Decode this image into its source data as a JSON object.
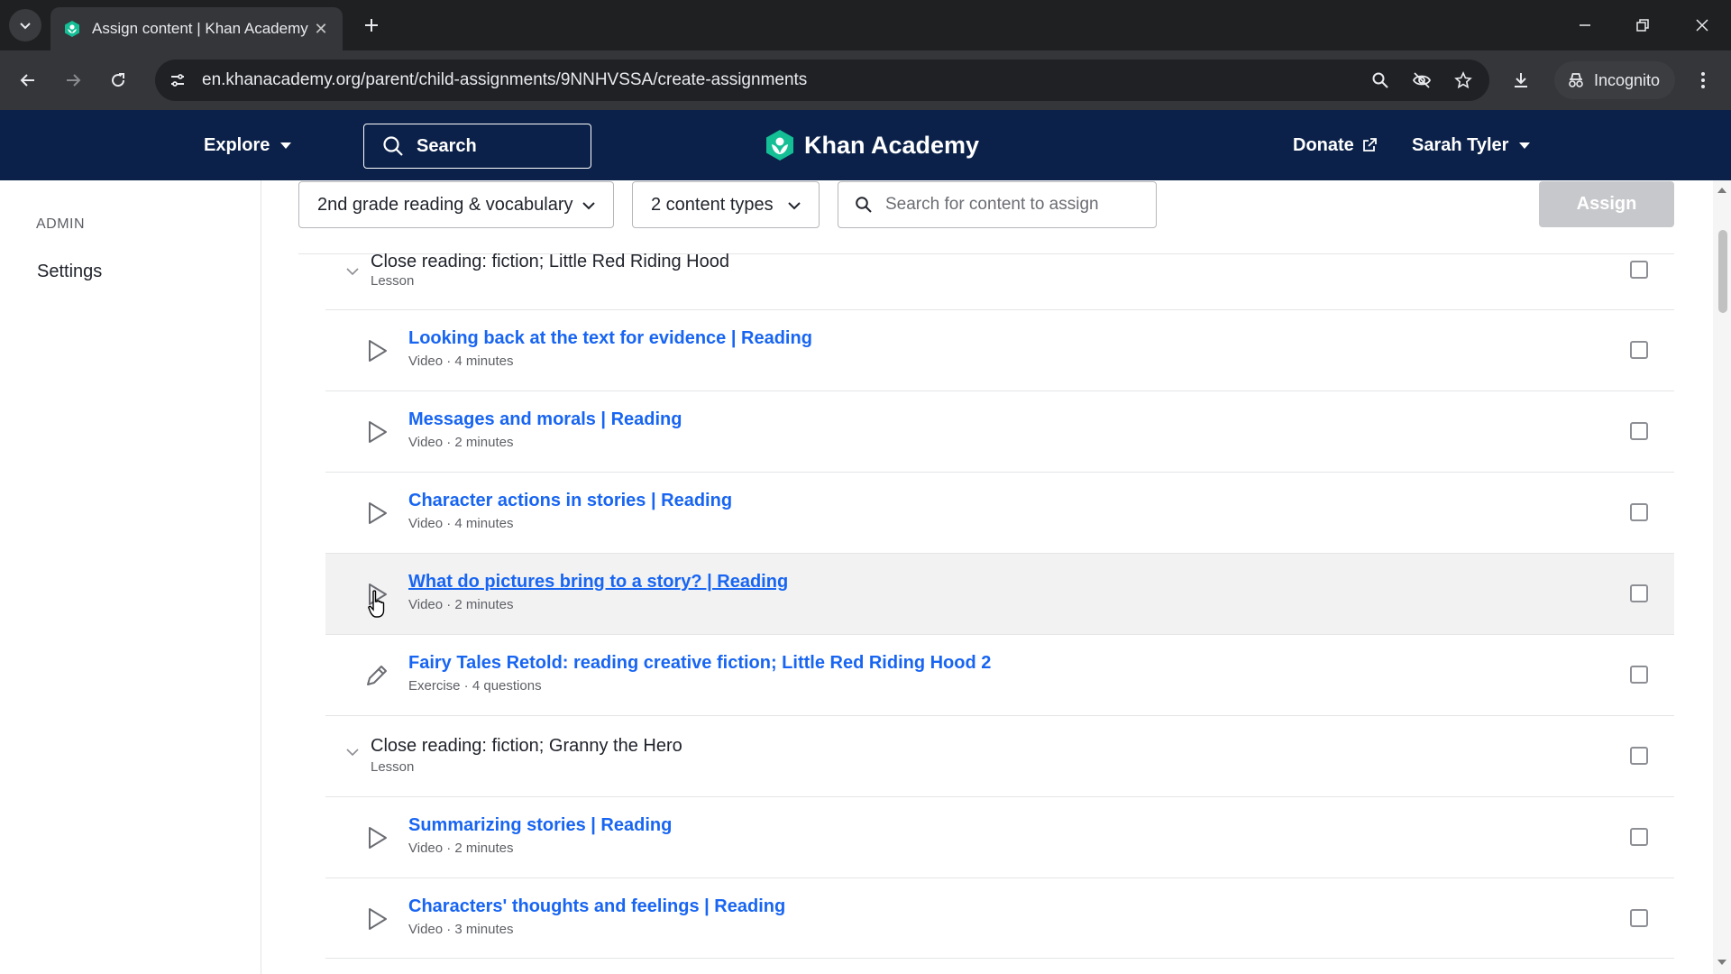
{
  "browser": {
    "tab_title": "Assign content | Khan Academy",
    "url": "en.khanacademy.org/parent/child-assignments/9NNHVSSA/create-assignments",
    "incognito_label": "Incognito"
  },
  "header": {
    "explore_label": "Explore",
    "search_label": "Search",
    "brand": "Khan Academy",
    "donate_label": "Donate",
    "user_name": "Sarah Tyler"
  },
  "sidebar": {
    "section_label": "ADMIN",
    "settings_label": "Settings"
  },
  "filters": {
    "course": "2nd grade reading & vocabulary",
    "content_types": "2 content types",
    "search_placeholder": "Search for content to assign",
    "assign_label": "Assign"
  },
  "content": {
    "lesson1": {
      "title": "Close reading: fiction; Little Red Riding Hood",
      "type": "Lesson"
    },
    "lesson2": {
      "title": "Close reading: fiction; Granny the Hero",
      "type": "Lesson"
    },
    "items": [
      {
        "title": "Looking back at the text for evidence | Reading",
        "meta": "Video · 4 minutes",
        "icon": "play-icon"
      },
      {
        "title": "Messages and morals | Reading",
        "meta": "Video · 2 minutes",
        "icon": "play-icon"
      },
      {
        "title": "Character actions in stories | Reading",
        "meta": "Video · 4 minutes",
        "icon": "play-icon"
      },
      {
        "title": "What do pictures bring to a story? | Reading",
        "meta": "Video · 2 minutes",
        "icon": "play-icon"
      },
      {
        "title": "Fairy Tales Retold: reading creative fiction; Little Red Riding Hood 2",
        "meta": "Exercise · 4 questions",
        "icon": "pencil-icon"
      },
      {
        "title": "Summarizing stories | Reading",
        "meta": "Video · 2 minutes",
        "icon": "play-icon"
      },
      {
        "title": "Characters' thoughts and feelings | Reading",
        "meta": "Video · 3 minutes",
        "icon": "play-icon"
      }
    ]
  },
  "colors": {
    "header_bg": "#0b2149",
    "link_blue": "#1865f2",
    "brand_green": "#14bf96"
  }
}
